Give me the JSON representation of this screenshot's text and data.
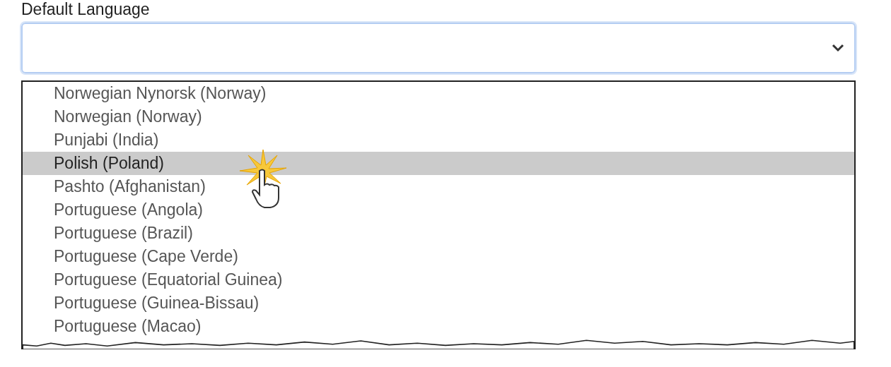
{
  "field": {
    "label": "Default Language"
  },
  "options": [
    {
      "label": "Norwegian Nynorsk (Norway)",
      "selected": false
    },
    {
      "label": "Norwegian (Norway)",
      "selected": false
    },
    {
      "label": "Punjabi (India)",
      "selected": false
    },
    {
      "label": "Polish (Poland)",
      "selected": true
    },
    {
      "label": "Pashto (Afghanistan)",
      "selected": false
    },
    {
      "label": "Portuguese (Angola)",
      "selected": false
    },
    {
      "label": "Portuguese (Brazil)",
      "selected": false
    },
    {
      "label": "Portuguese (Cape Verde)",
      "selected": false
    },
    {
      "label": "Portuguese (Equatorial Guinea)",
      "selected": false
    },
    {
      "label": "Portuguese (Guinea-Bissau)",
      "selected": false
    },
    {
      "label": "Portuguese (Macao)",
      "selected": false
    }
  ]
}
